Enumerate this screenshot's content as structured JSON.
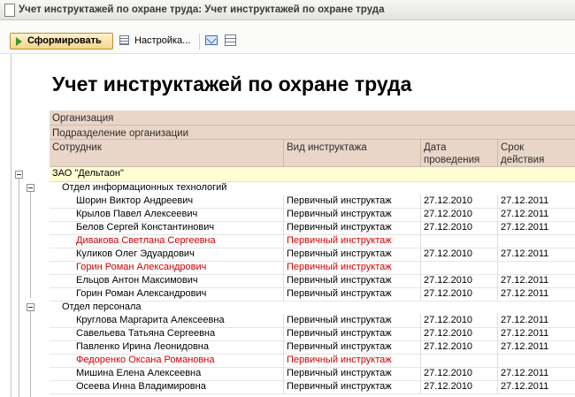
{
  "window": {
    "title": "Учет инструктажей по охране труда: Учет инструктажей по охране труда"
  },
  "toolbar": {
    "generate_label": "Сформировать",
    "settings_label": "Настройка..."
  },
  "report": {
    "title": "Учет инструктажей по охране труда",
    "header": {
      "organization": "Организация",
      "subdivision": "Подразделение организации",
      "employee": "Сотрудник",
      "briefing_type": "Вид инструктажа",
      "date_line1": "Дата",
      "date_line2": "проведения",
      "term_line1": "Срок",
      "term_line2": "действия"
    },
    "organization": "ЗАО \"Дельтаон\"",
    "groups": [
      {
        "name": "Отдел информационных технологий"
      },
      {
        "name": "Отдел персонала"
      }
    ],
    "rows": [
      {
        "employee": "Шорин Виктор Андреевич",
        "type": "Первичный инструктаж",
        "date": "27.12.2010",
        "term": "27.12.2011"
      },
      {
        "employee": "Крылов Павел Алексеевич",
        "type": "Первичный инструктаж",
        "date": "27.12.2010",
        "term": "27.12.2011"
      },
      {
        "employee": "Белов Сергей Константинович",
        "type": "Первичный инструктаж",
        "date": "27.12.2010",
        "term": "27.12.2011"
      },
      {
        "employee": "Дивакова Светлана Сергеевна",
        "type": "Первичный инструктаж",
        "date": "",
        "term": ""
      },
      {
        "employee": "Куликов Олег Эдуардович",
        "type": "Первичный инструктаж",
        "date": "27.12.2010",
        "term": "27.12.2011"
      },
      {
        "employee": "Горин Роман Александрович",
        "type": "Первичный инструктаж",
        "date": "",
        "term": ""
      },
      {
        "employee": "Ельцов Антон Максимович",
        "type": "Первичный инструктаж",
        "date": "27.12.2010",
        "term": "27.12.2011"
      },
      {
        "employee": "Горин Роман Александрович",
        "type": "Первичный инструктаж",
        "date": "27.12.2010",
        "term": "27.12.2011"
      },
      {
        "employee": "Круглова Маргарита Алексеевна",
        "type": "Первичный инструктаж",
        "date": "27.12.2010",
        "term": "27.12.2011"
      },
      {
        "employee": "Савельева Татьяна Сергеевна",
        "type": "Первичный инструктаж",
        "date": "27.12.2010",
        "term": "27.12.2011"
      },
      {
        "employee": "Павленко Ирина Леонидовна",
        "type": "Первичный инструктаж",
        "date": "27.12.2010",
        "term": "27.12.2011"
      },
      {
        "employee": "Федоренко Оксана Романовна",
        "type": "Первичный инструктаж",
        "date": "",
        "term": ""
      },
      {
        "employee": "Мишина Елена Алексеевна",
        "type": "Первичный инструктаж",
        "date": "27.12.2010",
        "term": "27.12.2011"
      },
      {
        "employee": "Осеева Инна Владимировна",
        "type": "Первичный инструктаж",
        "date": "27.12.2010",
        "term": "27.12.2011"
      }
    ],
    "colors": {
      "header_bg": "#ead6c8",
      "org_bg": "#fffed3",
      "overdue": "#d10000"
    }
  }
}
